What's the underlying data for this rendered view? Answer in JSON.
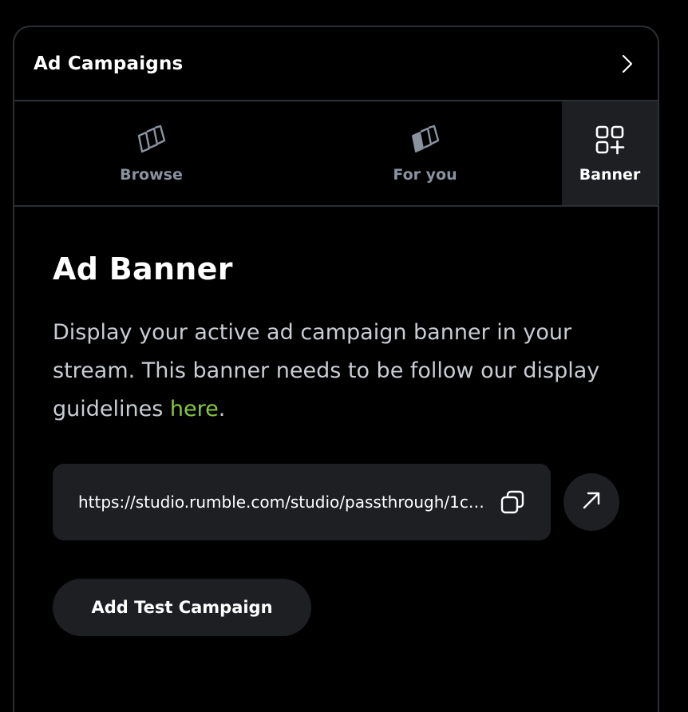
{
  "header": {
    "title": "Ad Campaigns",
    "chevron_icon": "chevron-right-icon"
  },
  "tabs": [
    {
      "label": "Browse",
      "icon": "stacked-cards-outline-icon",
      "active": false
    },
    {
      "label": "For you",
      "icon": "stacked-cards-filled-icon",
      "active": false
    },
    {
      "label": "Banner",
      "icon": "grid-add-icon",
      "active": true
    }
  ],
  "content": {
    "heading": "Ad Banner",
    "description": "Display your active ad campaign banner in your stream. This banner needs to be follow our display guidelines ",
    "link_text": "here",
    "description_end": ".",
    "url": "https://studio.rumble.com/studio/passthrough/1ce7...",
    "copy_icon": "copy-icon",
    "open_icon": "arrow-up-right-icon",
    "add_button_label": "Add Test Campaign"
  },
  "colors": {
    "background": "#000000",
    "surface": "#1d1f23",
    "border": "#2b2e33",
    "muted_text": "#8a929f",
    "link": "#85c742"
  }
}
